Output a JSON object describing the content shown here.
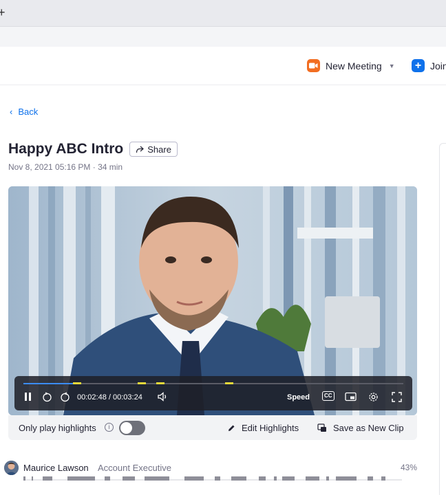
{
  "browser": {
    "new_tab_symbol": "+"
  },
  "header": {
    "new_meeting_label": "New Meeting",
    "join_label": "Join",
    "accent_orange": "#f26d21",
    "accent_blue": "#0e71eb"
  },
  "nav": {
    "back_label": "Back"
  },
  "recording": {
    "title": "Happy ABC Intro",
    "share_label": "Share",
    "meta": "Nov 8, 2021 05:16 PM · 34 min"
  },
  "player": {
    "time_display": "00:02:48 / 00:03:24",
    "speed_label": "Speed",
    "cc_label": "CC",
    "progress": 0.13,
    "highlight_marks": [
      0.13,
      0.3,
      0.35,
      0.53
    ]
  },
  "highlights_bar": {
    "only_play_label": "Only play highlights",
    "toggle_on": false,
    "edit_label": "Edit Highlights",
    "save_clip_label": "Save as New Clip"
  },
  "speaker": {
    "name": "Maurice Lawson",
    "role": "Account Executive",
    "talk_percent": "43%"
  }
}
